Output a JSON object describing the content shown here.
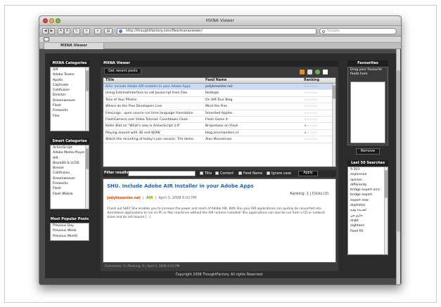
{
  "window": {
    "title": "MXNA Viewer"
  },
  "toolbar": {
    "url": "http://thoughtfactory.com/flex/mxnaviewer/",
    "search_placeholder": "Google"
  },
  "tab": {
    "label": "MXNA Viewer"
  },
  "categories": {
    "title": "MXNA Categories",
    "items": [
      "AIR",
      "Adobe Teams",
      "Apollo",
      "Captivate",
      "Coldfusion",
      "Director",
      "Dreamweaver",
      "Flash",
      "Fireworks",
      "Flex"
    ]
  },
  "smart_categories": {
    "title": "Smart Categories",
    "items": [
      "ActionScript",
      "Adobe Media Player",
      "AIR",
      "BlazeDS & LCDS",
      "Breeze",
      "Coldfusion",
      "Dreamweaver",
      "Fireworks",
      "Flash",
      "Flash Mobile"
    ]
  },
  "popular_posts": {
    "title": "Most Popular Posts",
    "items": [
      "Previous Day",
      "Previous Week",
      "Previous Month"
    ]
  },
  "main": {
    "header": "MXNA Viewer",
    "recent_button": "Get recent posts",
    "columns": [
      "Title",
      "Feed Name",
      "Ranking"
    ],
    "rows": [
      {
        "title": "SHU. Include Adobe AIR Installer in your Adobe Apps",
        "feed": "jodybrewster.net",
        "rank": "☆☆☆☆☆",
        "selected": true
      },
      {
        "title": "Using ExternalInterface to call Javascript from Flex",
        "feed": "Redlogic",
        "rank": "☆☆☆☆☆"
      },
      {
        "title": "Tons of Your Photos",
        "feed": "On AIR Tour Blog",
        "rank": "☆☆☆☆☆"
      },
      {
        "title": "Where do the Flex Developers Live",
        "feed": "Mind the Flex",
        "rank": "☆☆☆☆☆"
      },
      {
        "title": "FlexLingo : open source run time language translation",
        "feed": "Smashed Apples",
        "rank": "☆☆☆☆☆"
      },
      {
        "title": "FlashGamerz.com Video Tutorial: Countdown Clock",
        "feed": "Flash Game it",
        "rank": "☆☆☆☆☆"
      },
      {
        "title": "Keller Blot on \"What's new in ActionScript 3.0\"",
        "feed": "Brajeshwar on Flash",
        "rank": "★☆☆☆☆"
      },
      {
        "title": "Playing around with 3D and WOW",
        "feed": "blog.amcmanders.nl",
        "rank": "★☆☆☆☆"
      },
      {
        "title": "Watch the recording of today's jam session. Tim demo",
        "feed": "Alan Musselman",
        "rank": "☆☆☆☆☆"
      }
    ],
    "filter": {
      "label": "Filter results",
      "options": [
        "Title",
        "Content",
        "Feed Name",
        "Ignore case"
      ],
      "apply": "Apply"
    },
    "detail": {
      "title": "SHU. Include Adobe AIR Installer in your Adobe Apps",
      "source": "jodybrewster.net",
      "category": "AIR",
      "date": "April 3, 2008  6:02 PM",
      "rating": "Ranking: 1  |  Clicks (3)",
      "body": "Check out SHU! Shu enables you to increase the power and reach of Adobe AIR. With Shu your AIR applications can quickly be converted into standalone applications to run on PC or Mac machines without the AIR runtime installed! Shu applications can also be run from a CD or network share and do not require [...]"
    },
    "status": "Comments: 0  |  Ranking: 0  |  April 3, 2008  6:02 PM",
    "footer": "Copyright 2008 ThoughtFactory. All rights Reserved."
  },
  "favourites": {
    "title": "Favourites",
    "description": "Drag your favourite feeds here",
    "remove": "Remove"
  },
  "last_searches": {
    "title": "Last 50 Searches",
    "items": [
      "9.303",
      "expensive",
      "opinion",
      "differently",
      "bridge expert amc",
      "bridge expert",
      "expert new",
      "dophotos",
      "لجديدة وقبة",
      "جاري في",
      "dnjbt",
      "eighteen",
      "fixed fill"
    ]
  }
}
